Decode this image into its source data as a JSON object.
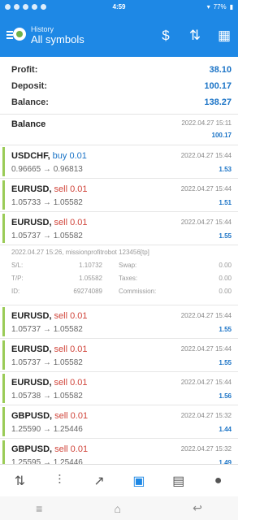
{
  "status_bar": {
    "time": "4:59",
    "battery": "77%"
  },
  "header": {
    "subtitle": "History",
    "title": "All symbols"
  },
  "summary": [
    {
      "label": "Profit:",
      "value": "38.10"
    },
    {
      "label": "Deposit:",
      "value": "100.17"
    },
    {
      "label": "Balance:",
      "value": "138.27"
    }
  ],
  "balance_entry": {
    "title": "Balance",
    "date": "2022.04.27 15:11",
    "amount": "100.17"
  },
  "deals": [
    {
      "symbol": "USDCHF,",
      "side": "buy 0.01",
      "date": "2022.04.27 15:44",
      "prices": "0.96665 → 0.96813",
      "profit": "1.53"
    },
    {
      "symbol": "EURUSD,",
      "side": "sell 0.01",
      "date": "2022.04.27 15:44",
      "prices": "1.05733 → 1.05582",
      "profit": "1.51"
    },
    {
      "symbol": "EURUSD,",
      "side": "sell 0.01",
      "date": "2022.04.27 15:44",
      "prices": "1.05737 → 1.05582",
      "profit": "1.55"
    }
  ],
  "details": {
    "info": "2022.04.27 15:26, missionprofitrobot 123456[tp]",
    "sl_label": "S/L:",
    "sl_value": "1.10732",
    "swap_label": "Swap:",
    "swap_value": "0.00",
    "tp_label": "T/P:",
    "tp_value": "1.05582",
    "taxes_label": "Taxes:",
    "taxes_value": "0.00",
    "id_label": "ID:",
    "id_value": "69274089",
    "commission_label": "Commission:",
    "commission_value": "0.00"
  },
  "deals2": [
    {
      "symbol": "EURUSD,",
      "side": "sell 0.01",
      "date": "2022.04.27 15:44",
      "prices": "1.05737 → 1.05582",
      "profit": "1.55"
    },
    {
      "symbol": "EURUSD,",
      "side": "sell 0.01",
      "date": "2022.04.27 15:44",
      "prices": "1.05737 → 1.05582",
      "profit": "1.55"
    },
    {
      "symbol": "EURUSD,",
      "side": "sell 0.01",
      "date": "2022.04.27 15:44",
      "prices": "1.05738 → 1.05582",
      "profit": "1.56"
    },
    {
      "symbol": "GBPUSD,",
      "side": "sell 0.01",
      "date": "2022.04.27 15:32",
      "prices": "1.25590 → 1.25446",
      "profit": "1.44"
    },
    {
      "symbol": "GBPUSD,",
      "side": "sell 0.01",
      "date": "2022.04.27 15:32",
      "prices": "1.25595 → 1.25446",
      "profit": "1.49"
    }
  ],
  "colors": {
    "accent": "#1e88e5",
    "profit": "#1a73c6",
    "sell": "#d0443a",
    "buy": "#1a73c6",
    "bar": "#9acb57"
  },
  "nav_icons": [
    "quotes-icon",
    "chart-icon",
    "trade-icon",
    "history-icon",
    "news-icon",
    "messages-icon"
  ]
}
